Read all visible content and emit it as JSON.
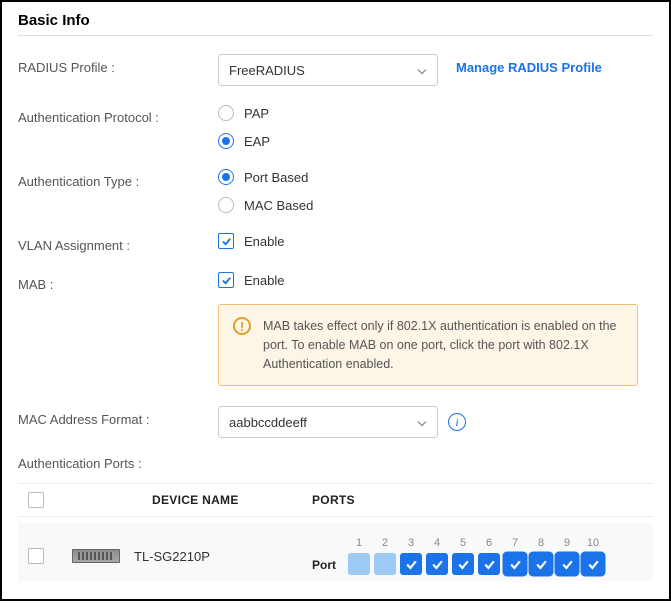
{
  "section_title": "Basic Info",
  "radius": {
    "label": "RADIUS Profile :",
    "value": "FreeRADIUS",
    "manage_link": "Manage RADIUS Profile"
  },
  "auth_protocol": {
    "label": "Authentication Protocol :",
    "options": {
      "pap": "PAP",
      "eap": "EAP"
    },
    "selected": "eap"
  },
  "auth_type": {
    "label": "Authentication Type :",
    "options": {
      "port": "Port Based",
      "mac": "MAC Based"
    },
    "selected": "port"
  },
  "vlan": {
    "label": "VLAN Assignment :",
    "option": "Enable",
    "checked": true
  },
  "mab": {
    "label": "MAB :",
    "option": "Enable",
    "checked": true
  },
  "mab_info": "MAB takes effect only if 802.1X authentication is enabled on the port. To enable MAB on one port, click the port with 802.1X Authentication enabled.",
  "mac_fmt": {
    "label": "MAC Address Format :",
    "value": "aabbccddeeff"
  },
  "auth_ports_label": "Authentication Ports :",
  "table": {
    "headers": {
      "device": "DEVICE NAME",
      "ports": "PORTS"
    },
    "row": {
      "device_name": "TL-SG2210P",
      "port_label": "Port",
      "ports": [
        {
          "n": "1",
          "state": "unchecked",
          "bordered": false
        },
        {
          "n": "2",
          "state": "unchecked",
          "bordered": false
        },
        {
          "n": "3",
          "state": "checked",
          "bordered": false
        },
        {
          "n": "4",
          "state": "checked",
          "bordered": false
        },
        {
          "n": "5",
          "state": "checked",
          "bordered": false
        },
        {
          "n": "6",
          "state": "checked",
          "bordered": false
        },
        {
          "n": "7",
          "state": "checked",
          "bordered": true
        },
        {
          "n": "8",
          "state": "checked",
          "bordered": true
        },
        {
          "n": "9",
          "state": "checked",
          "bordered": true
        },
        {
          "n": "10",
          "state": "checked",
          "bordered": true
        }
      ]
    }
  }
}
